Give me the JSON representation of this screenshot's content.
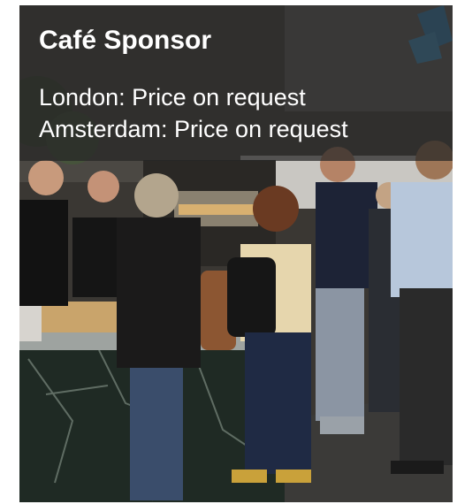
{
  "card": {
    "title": "Café Sponsor",
    "prices": [
      {
        "city": "London",
        "text": "London: Price on request"
      },
      {
        "city": "Amsterdam",
        "text": "Amsterdam: Price on request"
      }
    ],
    "overlay_color": "#262626",
    "text_color": "#ffffff"
  },
  "photo": {
    "subject": "café counter photo"
  }
}
